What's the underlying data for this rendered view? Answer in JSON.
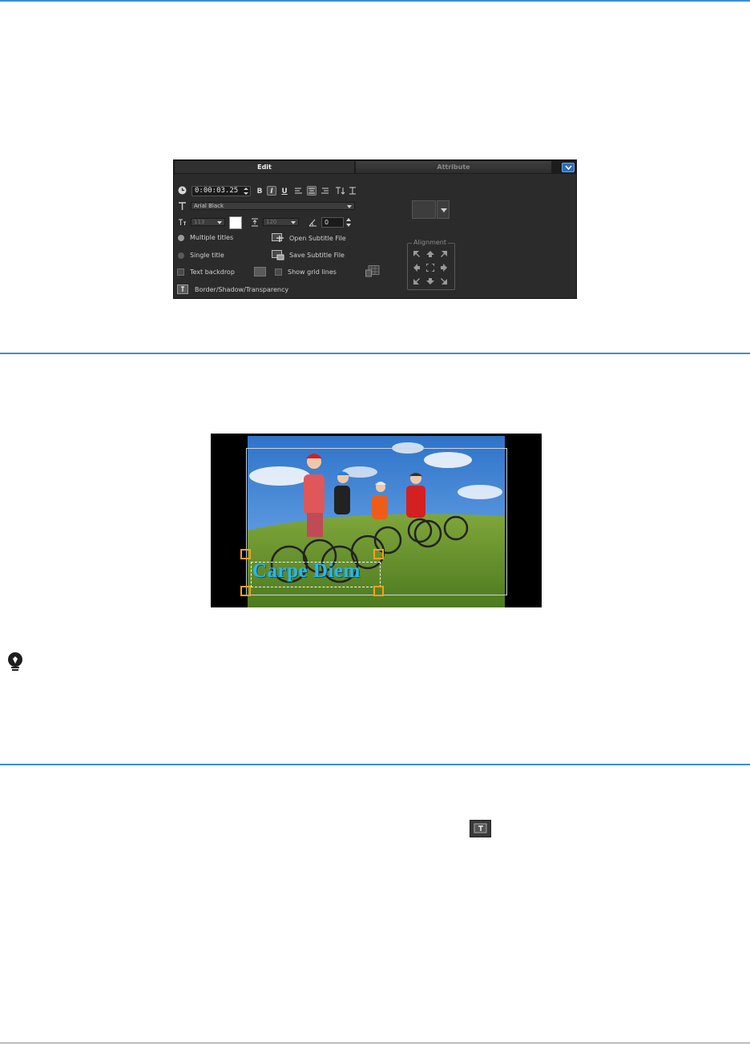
{
  "panel": {
    "tabs": {
      "edit": "Edit",
      "attribute": "Attribute"
    },
    "timecode": "0:00:03.25",
    "toolbar": {
      "bold": "B",
      "italic": "I",
      "underline": "U"
    },
    "font_name": "Arial Black",
    "font_size": "113",
    "line_spacing": "120",
    "rotation": "0",
    "multiple_titles": "Multiple titles",
    "single_title": "Single title",
    "open_subtitle": "Open Subtitle File",
    "save_subtitle": "Save Subtitle File",
    "text_backdrop": "Text backdrop",
    "show_grid_lines": "Show grid lines",
    "border_shadow": "Border/Shadow/Transparency",
    "alignment_title": "Alignment"
  },
  "preview": {
    "title_text": "Carpe Diem"
  },
  "colors": {
    "rule": "#3a8fd6",
    "panel_bg": "#2b2b2b",
    "title_text": "#2cb7e6",
    "handle": "#f5a020"
  }
}
